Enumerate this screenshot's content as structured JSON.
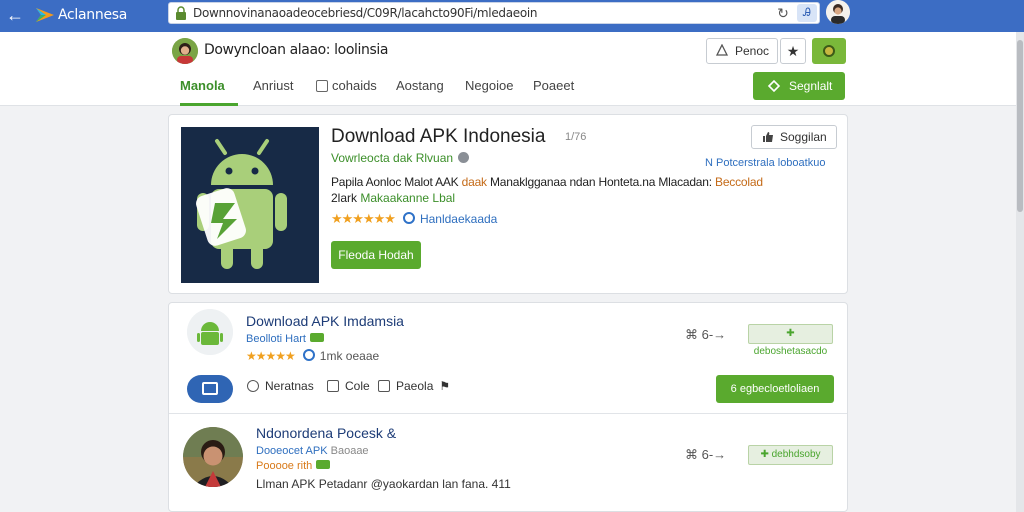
{
  "browser": {
    "back_icon": "arrow-left-icon",
    "app_name": "Aclannesa",
    "url": "Downnovinanaoadeocebriesd/C09R/lacahcto90Fi/mledaeoin",
    "reload_icon": "reload-icon",
    "extension_icon": "extension-icon",
    "extension_glyph": "Ꭿ"
  },
  "header": {
    "site_title": "Dowyncloan alaao: loolinsia",
    "notification_label": "Penoc",
    "star_icon": "★",
    "segment_label": "Segnlalt"
  },
  "tabs": [
    {
      "label": "Manola",
      "active": true
    },
    {
      "label": "Anriust",
      "active": false
    },
    {
      "label": "cohaids",
      "active": false
    },
    {
      "label": "Aostang",
      "active": false
    },
    {
      "label": "Negoioe",
      "active": false
    },
    {
      "label": "Poaeet",
      "active": false
    }
  ],
  "app": {
    "title": "Download APK Indonesia",
    "count": "1/76",
    "subtitle": "Vowrleocta dak Rlvuan",
    "desc1_a": "Papila Aonloc Malot AAK ",
    "desc1_hl": "daak",
    "desc1_b": " Manaklgganaa ndan Honteta.na Mlacadan: ",
    "desc1_hl2": "Beccolad",
    "desc2_a": "2lark ",
    "desc2_hl": "Makaakanne Lbal",
    "stars": "★★★★★★",
    "rating_label": "Hanldaekaada",
    "primary_button": "Fleoda Hodah",
    "share_button": "Soggilan",
    "side_link": "N Potcerstrala loboatkuo"
  },
  "list": [
    {
      "title": "Download APK Imdamsia",
      "subtitle": "Beolloti Hart",
      "stars": "★★★★★",
      "rating_text": "1mk oeaae",
      "pill": "✚ deboshetasacdo",
      "actions": [
        "Neratnas",
        "Cole",
        "Paeola"
      ],
      "green_action": "6 egbecloetloliaen"
    },
    {
      "title": "Ndonordena Pocesk &",
      "subtitle": "Dooeocet APK",
      "subtitle_extra": "Baoaae",
      "subtitle2": "Pooooe rith",
      "description": "Llman APK Petadanr @yaokardan lan fana. 411",
      "pill": "✚ debhdsoby"
    }
  ],
  "share_glyph": "⌘",
  "arrow_glyph": "6-→"
}
